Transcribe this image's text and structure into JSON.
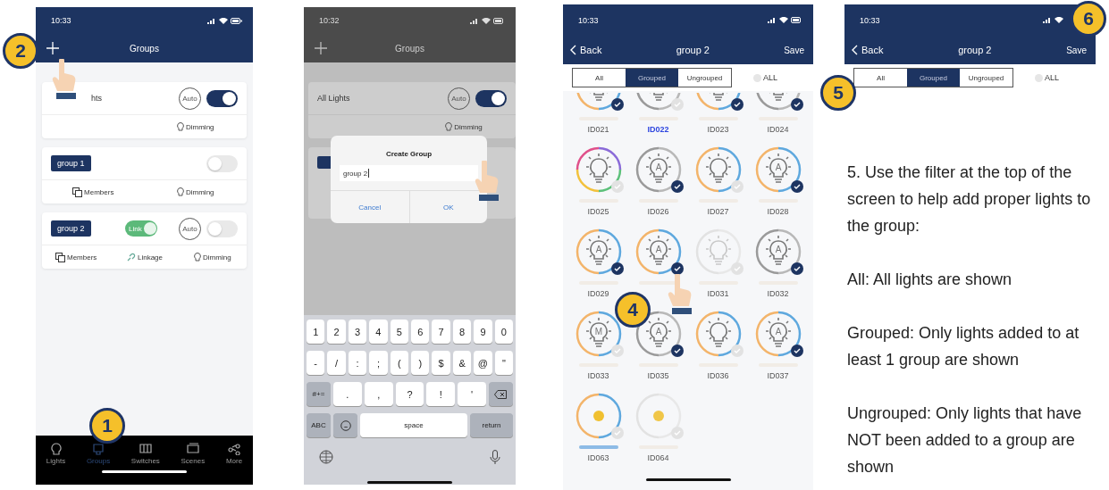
{
  "groups_screen": {
    "status_time": "10:33",
    "title": "Groups",
    "cards": [
      {
        "name": "hts",
        "chip": false,
        "auto": "Auto",
        "switch_on": true,
        "actions": [
          {
            "kind": "dimming",
            "label": "Dimming"
          }
        ]
      },
      {
        "name": "group 1",
        "chip": true,
        "switch_on": false,
        "actions": [
          {
            "kind": "members",
            "label": "Members"
          },
          {
            "kind": "dimming",
            "label": "Dimming"
          }
        ]
      },
      {
        "name": "group 2",
        "chip": true,
        "link": {
          "label": "Link",
          "on": true
        },
        "auto": "Auto",
        "switch_on": false,
        "actions": [
          {
            "kind": "members",
            "label": "Members"
          },
          {
            "kind": "linkage",
            "label": "Linkage"
          },
          {
            "kind": "dimming",
            "label": "Dimming"
          }
        ]
      }
    ],
    "tabs": [
      {
        "label": "Lights",
        "selected": false
      },
      {
        "label": "Groups",
        "selected": true
      },
      {
        "label": "Switches",
        "selected": false
      },
      {
        "label": "Scenes",
        "selected": false
      },
      {
        "label": "More",
        "selected": false
      }
    ],
    "steps": [
      "2",
      "1"
    ]
  },
  "create_group_screen": {
    "status_time": "10:32",
    "title": "Groups",
    "cards": [
      {
        "name": "All Lights",
        "chip": false,
        "auto": "Auto",
        "switch_on": true,
        "actions": [
          {
            "kind": "dimming",
            "label": "Dimming"
          }
        ]
      }
    ],
    "dialog": {
      "title": "Create Group",
      "value": "group 2",
      "buttons": [
        "Cancel",
        "OK"
      ]
    },
    "keyboard": [
      [
        {
          "kind": "char",
          "label": "1"
        },
        {
          "kind": "char",
          "label": "2"
        },
        {
          "kind": "char",
          "label": "3"
        },
        {
          "kind": "char",
          "label": "4"
        },
        {
          "kind": "char",
          "label": "5"
        },
        {
          "kind": "char",
          "label": "6"
        },
        {
          "kind": "char",
          "label": "7"
        },
        {
          "kind": "char",
          "label": "8"
        },
        {
          "kind": "char",
          "label": "9"
        },
        {
          "kind": "char",
          "label": "0"
        }
      ],
      [
        {
          "kind": "char",
          "label": "-"
        },
        {
          "kind": "char",
          "label": "/"
        },
        {
          "kind": "char",
          "label": ":"
        },
        {
          "kind": "char",
          "label": ";"
        },
        {
          "kind": "char",
          "label": "("
        },
        {
          "kind": "char",
          "label": ")"
        },
        {
          "kind": "char",
          "label": "$"
        },
        {
          "kind": "char",
          "label": "&"
        },
        {
          "kind": "char",
          "label": "@"
        },
        {
          "kind": "char",
          "label": "\""
        }
      ],
      [
        {
          "kind": "mod",
          "label": "#+="
        },
        {
          "kind": "wide",
          "label": "."
        },
        {
          "kind": "wide",
          "label": ","
        },
        {
          "kind": "wide",
          "label": "?"
        },
        {
          "kind": "wide",
          "label": "!"
        },
        {
          "kind": "wide",
          "label": "'"
        },
        {
          "kind": "backspace"
        }
      ],
      [
        {
          "kind": "mod",
          "label": "ABC"
        },
        {
          "kind": "emoji"
        },
        {
          "kind": "space",
          "label": "space"
        },
        {
          "kind": "return",
          "label": "return"
        }
      ],
      [
        {
          "kind": "globe"
        },
        {
          "kind": "gap"
        },
        {
          "kind": "mic"
        }
      ]
    ]
  },
  "select_lights_screen": {
    "status_time": "10:33",
    "back": "Back",
    "title": "group 2",
    "save": "Save",
    "filters": [
      {
        "label": "All",
        "selected": false
      },
      {
        "label": "Grouped",
        "selected": true
      },
      {
        "label": "Ungrouped",
        "selected": false
      }
    ],
    "select_all": {
      "label": "ALL",
      "checked": false
    },
    "lights": [
      {
        "label": "ID021",
        "kind": "tunable",
        "checked": true,
        "selected": false,
        "level": 0
      },
      {
        "label": "ID022",
        "kind": "white",
        "checked": false,
        "selected": true,
        "level": 0
      },
      {
        "label": "ID023",
        "kind": "tunable",
        "checked": true,
        "selected": false,
        "level": 0
      },
      {
        "label": "ID024",
        "kind": "white",
        "checked": true,
        "selected": false,
        "level": 0
      },
      {
        "label": "ID025",
        "kind": "rgb",
        "checked": false,
        "selected": false,
        "level": 0
      },
      {
        "label": "ID026",
        "kind": "white",
        "mode": "A",
        "checked": true,
        "selected": false,
        "level": 0
      },
      {
        "label": "ID027",
        "kind": "tunable",
        "checked": false,
        "selected": false,
        "level": 0
      },
      {
        "label": "ID028",
        "kind": "tunable",
        "mode": "A",
        "checked": true,
        "selected": false,
        "level": 0
      },
      {
        "label": "ID029",
        "kind": "tunable",
        "mode": "A",
        "checked": true,
        "selected": false,
        "level": 0
      },
      {
        "kind": "tunable",
        "mode": "A",
        "checked": true,
        "level": 0
      },
      {
        "label": "ID031",
        "kind": "faded",
        "checked": false,
        "selected": false,
        "level": 0
      },
      {
        "label": "ID032",
        "kind": "white",
        "mode": "A",
        "checked": true,
        "selected": false,
        "level": 0
      },
      {
        "label": "ID033",
        "kind": "tunable",
        "mode": "M",
        "checked": false,
        "selected": false,
        "level": 0
      },
      {
        "label": "ID035",
        "kind": "white",
        "mode": "A",
        "checked": true,
        "selected": false,
        "level": 0
      },
      {
        "label": "ID036",
        "kind": "tunable",
        "checked": false,
        "selected": false,
        "level": 0
      },
      {
        "label": "ID037",
        "kind": "tunable",
        "mode": "A",
        "checked": true,
        "selected": false,
        "level": 0
      },
      {
        "label": "ID063",
        "kind": "sensor",
        "checked": false,
        "selected": false,
        "level": 1
      },
      {
        "label": "ID064",
        "kind": "idle",
        "checked": false,
        "selected": false,
        "level": 0
      }
    ],
    "steps": [
      "4"
    ]
  },
  "header_crop": {
    "status_time": "10:33",
    "back": "Back",
    "title": "group 2",
    "save": "Save",
    "filters": [
      {
        "label": "All",
        "selected": false
      },
      {
        "label": "Grouped",
        "selected": true
      },
      {
        "label": "Ungrouped",
        "selected": false
      }
    ],
    "select_all": {
      "label": "ALL",
      "checked": false
    },
    "steps": [
      "6",
      "5"
    ]
  },
  "instructions": [
    "5. Use the filter at the top of the screen to help add proper lights to the group:",
    "All: All lights are shown",
    "Grouped: Only lights added to at least 1 group are shown",
    "Ungrouped: Only lights that have NOT been added to a group are shown"
  ]
}
